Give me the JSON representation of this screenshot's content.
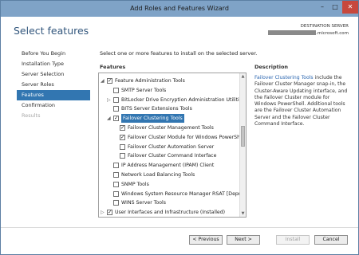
{
  "window": {
    "title": "Add Roles and Features Wizard"
  },
  "title_buttons": {
    "minimize": "–",
    "maximize": "□",
    "close": "✕"
  },
  "header": {
    "page_title": "Select features",
    "destination_label": "DESTINATION SERVER",
    "destination_value_suffix": ".microsoft.com"
  },
  "nav": {
    "items": [
      {
        "label": "Before You Begin",
        "state": "normal"
      },
      {
        "label": "Installation Type",
        "state": "normal"
      },
      {
        "label": "Server Selection",
        "state": "normal"
      },
      {
        "label": "Server Roles",
        "state": "normal"
      },
      {
        "label": "Features",
        "state": "active"
      },
      {
        "label": "Confirmation",
        "state": "normal"
      },
      {
        "label": "Results",
        "state": "disabled"
      }
    ]
  },
  "content": {
    "instruction": "Select one or more features to install on the selected server.",
    "features_label": "Features",
    "description_label": "Description"
  },
  "features": [
    {
      "label": "Feature Administration Tools",
      "checked": true,
      "expander": "◢",
      "level": 0
    },
    {
      "label": "SMTP Server Tools",
      "checked": false,
      "expander": "",
      "level": 1
    },
    {
      "label": "BitLocker Drive Encryption Administration Utilities",
      "checked": false,
      "expander": "▷",
      "level": 1
    },
    {
      "label": "BITS Server Extensions Tools",
      "checked": false,
      "expander": "",
      "level": 1
    },
    {
      "label": "Failover Clustering Tools",
      "checked": true,
      "expander": "◢",
      "level": 1,
      "selected": true
    },
    {
      "label": "Failover Cluster Management Tools",
      "checked": true,
      "expander": "",
      "level": 2
    },
    {
      "label": "Failover Cluster Module for Windows PowerShell",
      "checked": true,
      "expander": "",
      "level": 2
    },
    {
      "label": "Failover Cluster Automation Server",
      "checked": false,
      "expander": "",
      "level": 2
    },
    {
      "label": "Failover Cluster Command Interface",
      "checked": false,
      "expander": "",
      "level": 2
    },
    {
      "label": "IP Address Management (IPAM) Client",
      "checked": false,
      "expander": "",
      "level": 1
    },
    {
      "label": "Network Load Balancing Tools",
      "checked": false,
      "expander": "",
      "level": 1
    },
    {
      "label": "SNMP Tools",
      "checked": false,
      "expander": "",
      "level": 1
    },
    {
      "label": "Windows System Resource Manager RSAT [Deprecated]",
      "checked": false,
      "expander": "",
      "level": 1
    },
    {
      "label": "WINS Server Tools",
      "checked": false,
      "expander": "",
      "level": 1
    },
    {
      "label": "User Interfaces and Infrastructure (Installed)",
      "checked": true,
      "expander": "▷",
      "level": 0
    }
  ],
  "description": {
    "link_text": "Failover Clustering Tools",
    "text": " include the Failover Cluster Manager snap-in, the Cluster-Aware Updating interface, and the Failover Cluster module for Windows PowerShell. Additional tools are the Failover Cluster Automation Server and the Failover Cluster Command Interface."
  },
  "buttons": {
    "previous": "< Previous",
    "next": "Next >",
    "install": "Install",
    "cancel": "Cancel"
  },
  "scroll_glyphs": {
    "up": "▲",
    "down": "▼"
  },
  "colors": {
    "accent": "#3276b1",
    "title_bar": "#7fa3c7",
    "close": "#c7483d",
    "link": "#2b66b0"
  }
}
